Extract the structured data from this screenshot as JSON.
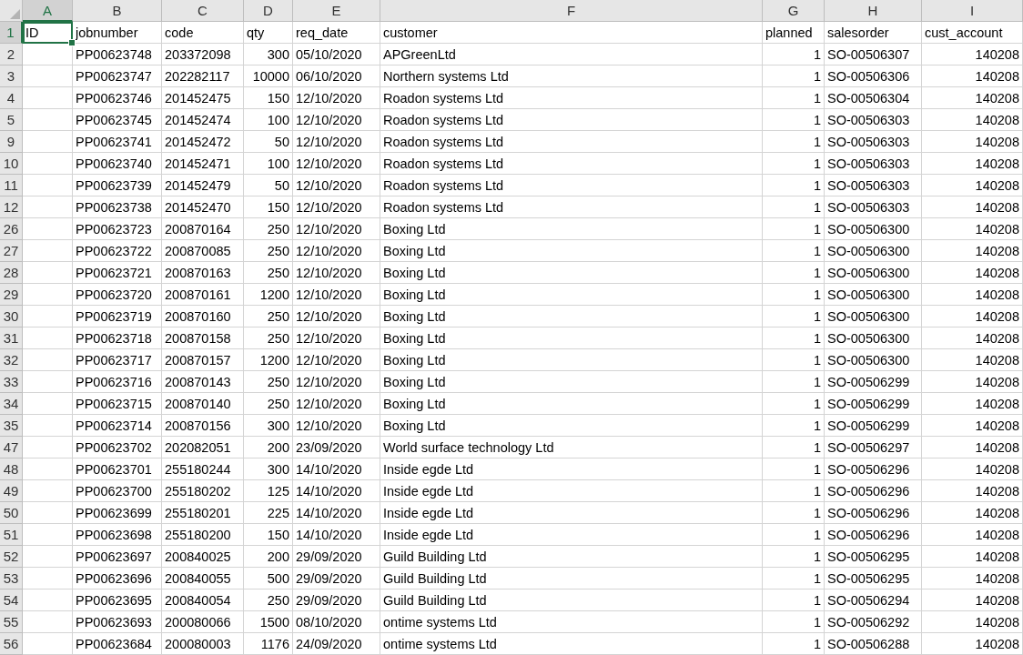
{
  "columns": [
    {
      "letter": "A",
      "selected": true,
      "kind": "text"
    },
    {
      "letter": "B",
      "selected": false,
      "kind": "text"
    },
    {
      "letter": "C",
      "selected": false,
      "kind": "text"
    },
    {
      "letter": "D",
      "selected": false,
      "kind": "number"
    },
    {
      "letter": "E",
      "selected": false,
      "kind": "text"
    },
    {
      "letter": "F",
      "selected": false,
      "kind": "text"
    },
    {
      "letter": "G",
      "selected": false,
      "kind": "number"
    },
    {
      "letter": "H",
      "selected": false,
      "kind": "text"
    },
    {
      "letter": "I",
      "selected": false,
      "kind": "number"
    }
  ],
  "rows": [
    {
      "number": "1",
      "selected": true,
      "header": true,
      "cells": {
        "A": "ID",
        "B": "jobnumber",
        "C": "code",
        "D": "qty",
        "E": "req_date",
        "F": "customer",
        "G": "planned",
        "H": "salesorder",
        "I": "cust_account"
      }
    },
    {
      "number": "2",
      "selected": false,
      "cells": {
        "B": "PP00623748",
        "C": "203372098",
        "D": "300",
        "E": "05/10/2020",
        "F": "APGreenLtd",
        "G": "1",
        "H": "SO-00506307",
        "I": "140208"
      }
    },
    {
      "number": "3",
      "selected": false,
      "cells": {
        "B": "PP00623747",
        "C": "202282117",
        "D": "10000",
        "E": "06/10/2020",
        "F": "Northern systems Ltd",
        "G": "1",
        "H": "SO-00506306",
        "I": "140208"
      }
    },
    {
      "number": "4",
      "selected": false,
      "cells": {
        "B": "PP00623746",
        "C": "201452475",
        "D": "150",
        "E": "12/10/2020",
        "F": "Roadon systems Ltd",
        "G": "1",
        "H": "SO-00506304",
        "I": "140208"
      }
    },
    {
      "number": "5",
      "selected": false,
      "cells": {
        "B": "PP00623745",
        "C": "201452474",
        "D": "100",
        "E": "12/10/2020",
        "F": "Roadon systems Ltd",
        "G": "1",
        "H": "SO-00506303",
        "I": "140208"
      }
    },
    {
      "number": "9",
      "selected": false,
      "cells": {
        "B": "PP00623741",
        "C": "201452472",
        "D": "50",
        "E": "12/10/2020",
        "F": "Roadon systems Ltd",
        "G": "1",
        "H": "SO-00506303",
        "I": "140208"
      }
    },
    {
      "number": "10",
      "selected": false,
      "cells": {
        "B": "PP00623740",
        "C": "201452471",
        "D": "100",
        "E": "12/10/2020",
        "F": "Roadon systems Ltd",
        "G": "1",
        "H": "SO-00506303",
        "I": "140208"
      }
    },
    {
      "number": "11",
      "selected": false,
      "cells": {
        "B": "PP00623739",
        "C": "201452479",
        "D": "50",
        "E": "12/10/2020",
        "F": "Roadon systems Ltd",
        "G": "1",
        "H": "SO-00506303",
        "I": "140208"
      }
    },
    {
      "number": "12",
      "selected": false,
      "cells": {
        "B": "PP00623738",
        "C": "201452470",
        "D": "150",
        "E": "12/10/2020",
        "F": "Roadon systems Ltd",
        "G": "1",
        "H": "SO-00506303",
        "I": "140208"
      }
    },
    {
      "number": "26",
      "selected": false,
      "cells": {
        "B": "PP00623723",
        "C": "200870164",
        "D": "250",
        "E": "12/10/2020",
        "F": "Boxing Ltd",
        "G": "1",
        "H": "SO-00506300",
        "I": "140208"
      }
    },
    {
      "number": "27",
      "selected": false,
      "cells": {
        "B": "PP00623722",
        "C": "200870085",
        "D": "250",
        "E": "12/10/2020",
        "F": "Boxing Ltd",
        "G": "1",
        "H": "SO-00506300",
        "I": "140208"
      }
    },
    {
      "number": "28",
      "selected": false,
      "cells": {
        "B": "PP00623721",
        "C": "200870163",
        "D": "250",
        "E": "12/10/2020",
        "F": "Boxing Ltd",
        "G": "1",
        "H": "SO-00506300",
        "I": "140208"
      }
    },
    {
      "number": "29",
      "selected": false,
      "cells": {
        "B": "PP00623720",
        "C": "200870161",
        "D": "1200",
        "E": "12/10/2020",
        "F": "Boxing Ltd",
        "G": "1",
        "H": "SO-00506300",
        "I": "140208"
      }
    },
    {
      "number": "30",
      "selected": false,
      "cells": {
        "B": "PP00623719",
        "C": "200870160",
        "D": "250",
        "E": "12/10/2020",
        "F": "Boxing Ltd",
        "G": "1",
        "H": "SO-00506300",
        "I": "140208"
      }
    },
    {
      "number": "31",
      "selected": false,
      "cells": {
        "B": "PP00623718",
        "C": "200870158",
        "D": "250",
        "E": "12/10/2020",
        "F": "Boxing Ltd",
        "G": "1",
        "H": "SO-00506300",
        "I": "140208"
      }
    },
    {
      "number": "32",
      "selected": false,
      "cells": {
        "B": "PP00623717",
        "C": "200870157",
        "D": "1200",
        "E": "12/10/2020",
        "F": "Boxing Ltd",
        "G": "1",
        "H": "SO-00506300",
        "I": "140208"
      }
    },
    {
      "number": "33",
      "selected": false,
      "cells": {
        "B": "PP00623716",
        "C": "200870143",
        "D": "250",
        "E": "12/10/2020",
        "F": "Boxing Ltd",
        "G": "1",
        "H": "SO-00506299",
        "I": "140208"
      }
    },
    {
      "number": "34",
      "selected": false,
      "cells": {
        "B": "PP00623715",
        "C": "200870140",
        "D": "250",
        "E": "12/10/2020",
        "F": "Boxing Ltd",
        "G": "1",
        "H": "SO-00506299",
        "I": "140208"
      }
    },
    {
      "number": "35",
      "selected": false,
      "cells": {
        "B": "PP00623714",
        "C": "200870156",
        "D": "300",
        "E": "12/10/2020",
        "F": "Boxing Ltd",
        "G": "1",
        "H": "SO-00506299",
        "I": "140208"
      }
    },
    {
      "number": "47",
      "selected": false,
      "cells": {
        "B": "PP00623702",
        "C": "202082051",
        "D": "200",
        "E": "23/09/2020",
        "F": "World surface technology Ltd",
        "G": "1",
        "H": "SO-00506297",
        "I": "140208"
      }
    },
    {
      "number": "48",
      "selected": false,
      "cells": {
        "B": "PP00623701",
        "C": "255180244",
        "D": "300",
        "E": "14/10/2020",
        "F": "Inside egde Ltd",
        "G": "1",
        "H": "SO-00506296",
        "I": "140208"
      }
    },
    {
      "number": "49",
      "selected": false,
      "cells": {
        "B": "PP00623700",
        "C": "255180202",
        "D": "125",
        "E": "14/10/2020",
        "F": "Inside egde Ltd",
        "G": "1",
        "H": "SO-00506296",
        "I": "140208"
      }
    },
    {
      "number": "50",
      "selected": false,
      "cells": {
        "B": "PP00623699",
        "C": "255180201",
        "D": "225",
        "E": "14/10/2020",
        "F": "Inside egde Ltd",
        "G": "1",
        "H": "SO-00506296",
        "I": "140208"
      }
    },
    {
      "number": "51",
      "selected": false,
      "cells": {
        "B": "PP00623698",
        "C": "255180200",
        "D": "150",
        "E": "14/10/2020",
        "F": "Inside egde Ltd",
        "G": "1",
        "H": "SO-00506296",
        "I": "140208"
      }
    },
    {
      "number": "52",
      "selected": false,
      "cells": {
        "B": "PP00623697",
        "C": "200840025",
        "D": "200",
        "E": "29/09/2020",
        "F": "Guild Building Ltd",
        "G": "1",
        "H": "SO-00506295",
        "I": "140208"
      }
    },
    {
      "number": "53",
      "selected": false,
      "cells": {
        "B": "PP00623696",
        "C": "200840055",
        "D": "500",
        "E": "29/09/2020",
        "F": "Guild Building Ltd",
        "G": "1",
        "H": "SO-00506295",
        "I": "140208"
      }
    },
    {
      "number": "54",
      "selected": false,
      "cells": {
        "B": "PP00623695",
        "C": "200840054",
        "D": "250",
        "E": "29/09/2020",
        "F": "Guild Building Ltd",
        "G": "1",
        "H": "SO-00506294",
        "I": "140208"
      }
    },
    {
      "number": "55",
      "selected": false,
      "cells": {
        "B": "PP00623693",
        "C": "200080066",
        "D": "1500",
        "E": "08/10/2020",
        "F": "ontime systems Ltd",
        "G": "1",
        "H": "SO-00506292",
        "I": "140208"
      }
    },
    {
      "number": "56",
      "selected": false,
      "cells": {
        "B": "PP00623684",
        "C": "200080003",
        "D": "1176",
        "E": "24/09/2020",
        "F": "ontime systems Ltd",
        "G": "1",
        "H": "SO-00506288",
        "I": "140208"
      }
    }
  ]
}
